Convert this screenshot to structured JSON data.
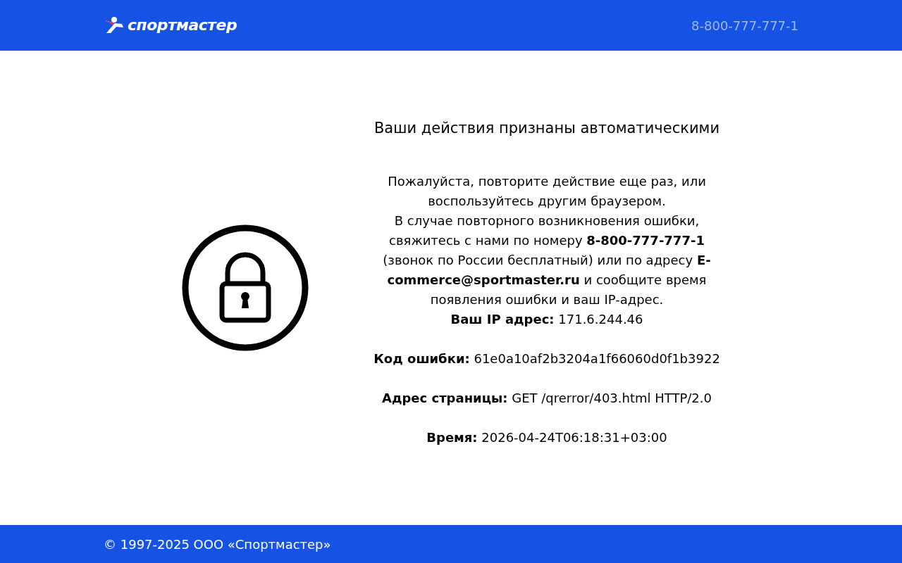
{
  "header": {
    "logo": "спортмастер",
    "phone": "8-800-777-777-1"
  },
  "title": "Ваши действия признаны автоматическими",
  "paragraphs": [
    "Пожалуйста, повторите действие еще раз, или воспользуйтесь другим браузером.",
    "В случае повторного возникновения ошибки, свяжитесь с нами по номеру **8-800-777-777-1** (звонок по России бесплатный) или по адресу **E-commerce@sportmaster.ru** и сообщите время появления ошибки и ваш IP-адрес."
  ],
  "details": [
    {
      "label": "Ваш IP адрес:",
      "value": "171.6.244.46"
    },
    {
      "label": "Код ошибки:",
      "value": "61e0a10af2b3204a1f66060d0f1b3922"
    },
    {
      "label": "Адрес страницы:",
      "value": "GET /qrerror/403.html HTTP/2.0"
    },
    {
      "label": "Время:",
      "value": "2026-04-24T06:18:31+03:00"
    }
  ],
  "footer": {
    "copyright": "© 1997-2025 ООО «Спортмастер»"
  }
}
